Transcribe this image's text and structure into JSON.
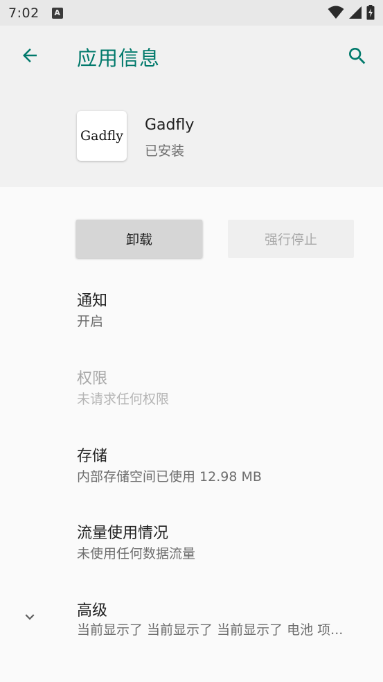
{
  "status_bar": {
    "time": "7:02",
    "indicator": "A"
  },
  "header": {
    "title": "应用信息"
  },
  "app": {
    "icon_text": "Gadfly",
    "name": "Gadfly",
    "status": "已安装"
  },
  "buttons": {
    "uninstall": "卸载",
    "force_stop": "强行停止"
  },
  "settings": [
    {
      "title": "通知",
      "subtitle": "开启",
      "enabled": true
    },
    {
      "title": "权限",
      "subtitle": "未请求任何权限",
      "enabled": false
    },
    {
      "title": "存储",
      "subtitle": "内部存储空间已使用 12.98 MB",
      "enabled": true
    },
    {
      "title": "流量使用情况",
      "subtitle": "未使用任何数据流量",
      "enabled": true
    },
    {
      "title": "高级",
      "subtitle": "当前显示了 当前显示了 当前显示了 电池 项...",
      "enabled": true
    }
  ],
  "colors": {
    "accent": "#00796b",
    "header_bg": "#f1f1f1",
    "page_bg": "#fafafa"
  },
  "icons": [
    "back-arrow-icon",
    "search-icon",
    "chevron-down-icon",
    "wifi-icon",
    "signal-icon",
    "battery-icon"
  ]
}
